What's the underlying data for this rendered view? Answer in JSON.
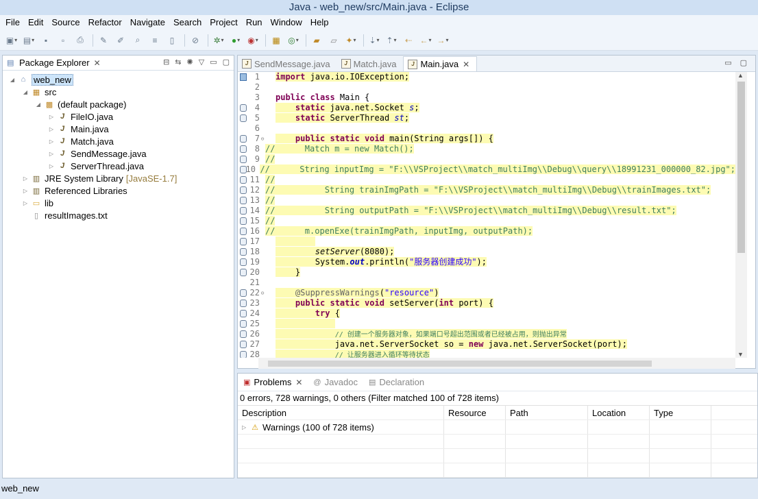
{
  "window": {
    "title": "Java - web_new/src/Main.java - Eclipse"
  },
  "menu": [
    "File",
    "Edit",
    "Source",
    "Refactor",
    "Navigate",
    "Search",
    "Project",
    "Run",
    "Window",
    "Help"
  ],
  "package_explorer": {
    "title": "Package Explorer",
    "project": "web_new",
    "src": "src",
    "default_package": "(default package)",
    "files": [
      "FileIO.java",
      "Main.java",
      "Match.java",
      "SendMessage.java",
      "ServerThread.java"
    ],
    "jre": "JRE System Library",
    "jre_decor": "[JavaSE-1.7]",
    "ref_libs": "Referenced Libraries",
    "lib": "lib",
    "results": "resultImages.txt"
  },
  "editor": {
    "tabs": [
      "SendMessage.java",
      "Match.java",
      "Main.java"
    ],
    "active_tab": "Main.java",
    "line_numbers": [
      "1",
      "2",
      "3",
      "4",
      "5",
      "6",
      "7",
      "8",
      "9",
      "10",
      "11",
      "12",
      "13",
      "14",
      "15",
      "16",
      "17",
      "18",
      "19",
      "20",
      "21",
      "22",
      "23",
      "24",
      "25",
      "26",
      "27",
      "28"
    ]
  },
  "problems": {
    "tabs": [
      "Problems",
      "Javadoc",
      "Declaration"
    ],
    "summary": "0 errors, 728 warnings, 0 others (Filter matched 100 of 728 items)",
    "columns": [
      "Description",
      "Resource",
      "Path",
      "Location",
      "Type"
    ],
    "row": "Warnings (100 of 728 items)"
  },
  "status": {
    "text": "web_new"
  },
  "colors": {
    "highlight": "#fdfbb3",
    "keyword": "#7f0055",
    "comment": "#3f7f5f",
    "string": "#2a00ff"
  }
}
